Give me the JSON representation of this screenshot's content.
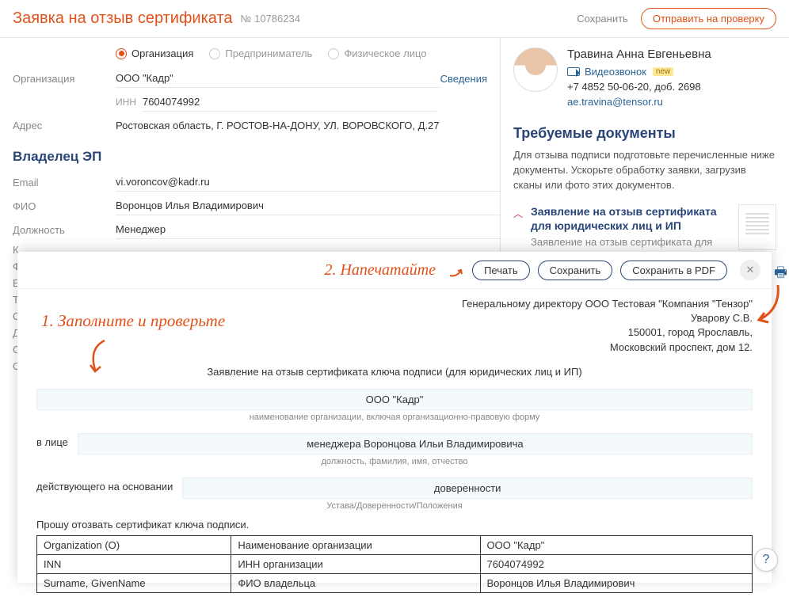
{
  "header": {
    "title": "Заявка на отзыв сертификата",
    "number": "№ 10786234",
    "save": "Сохранить",
    "submit": "Отправить на проверку"
  },
  "radios": {
    "org": "Организация",
    "ip": "Предприниматель",
    "phys": "Физическое лицо"
  },
  "form": {
    "org_label": "Организация",
    "org_value": "ООО \"Кадр\"",
    "details_link": "Сведения",
    "inn_label": "ИНН",
    "inn_value": "7604074992",
    "addr_label": "Адрес",
    "addr_value": "Ростовская область, Г. РОСТОВ-НА-ДОНУ, УЛ. ВОРОВСКОГО, Д.27"
  },
  "owner": {
    "title": "Владелец ЭП",
    "email_label": "Email",
    "email_value": "vi.voroncov@kadr.ru",
    "fio_label": "ФИО",
    "fio_value": "Воронцов Илья Владимирович",
    "position_label": "Должность",
    "position_value": "Менеджер"
  },
  "cut_rows": [
    "К",
    "Ф",
    "Е",
    "Т",
    "С",
    "Д",
    "С",
    "О"
  ],
  "contact": {
    "name": "Травина Анна Евгеньевна",
    "video": "Видеозвонок",
    "new_badge": "new",
    "phone": "+7 4852 50-06-20, доб. 2698",
    "email": "ae.travina@tensor.ru"
  },
  "docs": {
    "title": "Требуемые документы",
    "desc": "Для отзыва подписи подготовьте перечисленные ниже документы. Ускорьте обработку заявки, загрузив сканы или фото этих документов.",
    "item_title": "Заявление на отзыв сертификата для юридических лиц и ИП",
    "item_sub": "Заявление на отзыв сертификата для"
  },
  "overlay": {
    "annot2": "2. Напечатайте",
    "print": "Печать",
    "save": "Сохранить",
    "save_pdf": "Сохранить в PDF",
    "annot1": "1. Заполните и проверьте",
    "addr1": "Генеральному директору ООО Тестовая \"Компания \"Тензор\"",
    "addr2": "Уварову С.В.",
    "addr3": "150001, город Ярославль,",
    "addr4": "Московский проспект, дом 12.",
    "doctitle": "Заявление на отзыв сертификата ключа подписи (для юридических лиц и ИП)",
    "org": "ООО \"Кадр\"",
    "org_caption": "наименование организации, включая организационно-правовую форму",
    "person_label": "в лице",
    "person": "менеджера Воронцова Ильи Владимировича",
    "person_caption": "должность, фамилия, имя, отчество",
    "basis_label": "действующего на основании",
    "basis": "доверенности",
    "basis_caption": "Устава/Доверенности/Положения",
    "request": "Прошу отозвать сертификат ключа подписи.",
    "table": [
      [
        "Organization (O)",
        "Наименование организации",
        "ООО \"Кадр\""
      ],
      [
        "INN",
        "ИНН организации",
        "7604074992"
      ],
      [
        "Surname, GivenName",
        "ФИО владельца",
        "Воронцов Илья Владимирович"
      ]
    ]
  },
  "help": "?"
}
